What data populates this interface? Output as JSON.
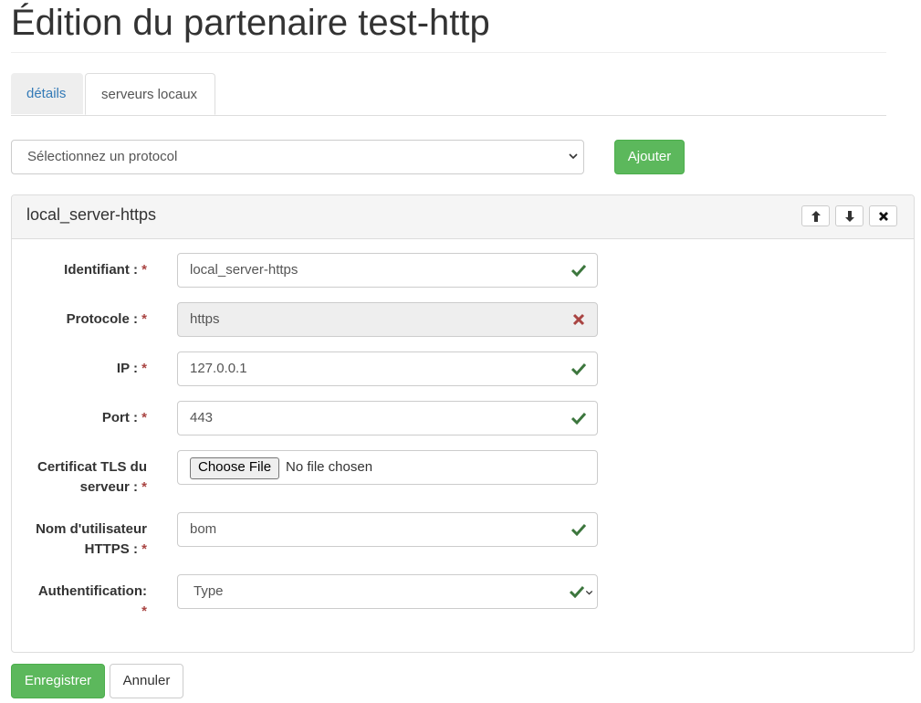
{
  "page": {
    "title": "Édition du partenaire test-http"
  },
  "tabs": [
    {
      "label": "détails"
    },
    {
      "label": "serveurs locaux"
    }
  ],
  "protocol_select": {
    "value": "Sélectionnez un protocol"
  },
  "add_button": {
    "label": "Ajouter"
  },
  "panel": {
    "title": "local_server-https",
    "icons": [
      "arrow-up-icon",
      "arrow-down-icon",
      "close-icon"
    ]
  },
  "form": {
    "id_label": "Identifiant :",
    "id_value": "local_server-https",
    "protocol_label": "Protocole :",
    "protocol_value": "https",
    "ip_label": "IP :",
    "ip_value": "127.0.0.1",
    "port_label": "Port :",
    "port_value": "443",
    "cert_label_1": "Certificat TLS du",
    "cert_label_2": "serveur :",
    "file_button": "Choose File",
    "file_status": "No file chosen",
    "user_label_1": "Nom d'utilisateur",
    "user_label_2": "HTTPS :",
    "user_value": "bom",
    "auth_label": "Authentification:",
    "auth_value": "Type",
    "required_mark": "*"
  },
  "footer": {
    "save_label": "Enregistrer",
    "cancel_label": "Annuler"
  },
  "colors": {
    "success": "#5cb85c",
    "valid": "#3c763d",
    "invalid": "#a94442",
    "link": "#337ab7"
  }
}
